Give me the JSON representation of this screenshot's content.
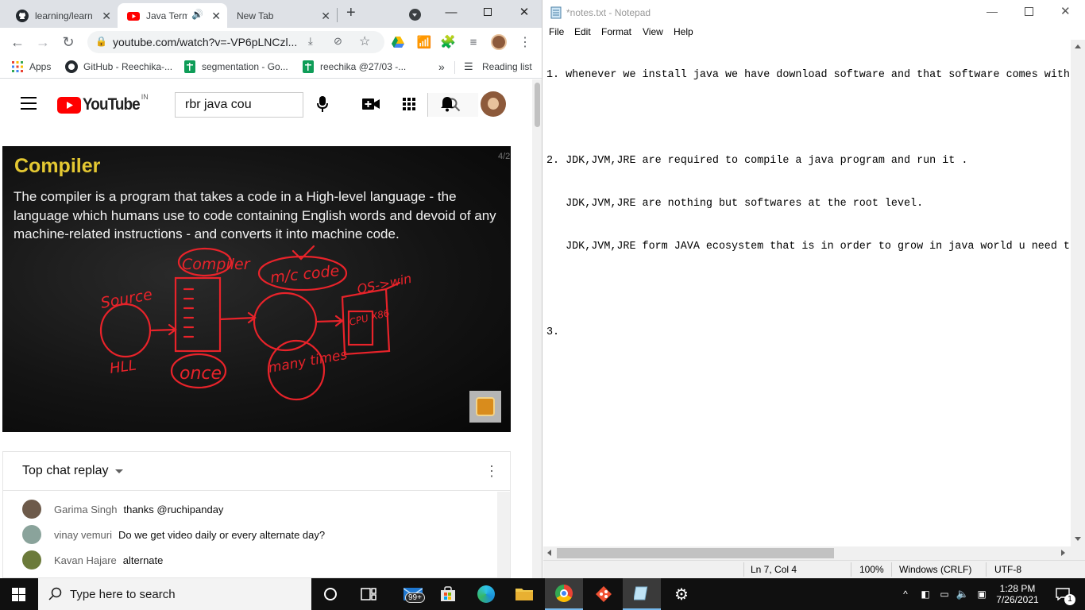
{
  "browser": {
    "tabs": [
      {
        "title": "learning/learn",
        "favicon": "github-icon"
      },
      {
        "title": "Java Term",
        "favicon": "youtube-icon",
        "audio": "speaker-icon"
      },
      {
        "title": "New Tab"
      }
    ],
    "url": "youtube.com/watch?v=-VP6pLNCzl...",
    "bookmarks": [
      {
        "label": "Apps"
      },
      {
        "label": "GitHub - Reechika-..."
      },
      {
        "label": "segmentation - Go..."
      },
      {
        "label": "reechika @27/03 -..."
      }
    ],
    "bookmarks_overflow": "»",
    "reading_list": "Reading list"
  },
  "youtube": {
    "logo": "YouTube",
    "country": "IN",
    "search_value": "rbr java cou",
    "video": {
      "slide_title": "Compiler",
      "slide_text": "The compiler is a program that takes a code in a High-level language - the language which humans use to code containing English words and devoid of any machine-related instructions - and converts it into machine code.",
      "slide_counter": "4/2",
      "handwriting": {
        "source": "Source",
        "compiler": "Compiler",
        "mc_code": "m/c code",
        "os_win": "OS->win",
        "cpu": "CPU X86",
        "hll": "HLL",
        "once": "once",
        "many_times": "many times"
      }
    },
    "chat": {
      "header": "Top chat replay",
      "messages": [
        {
          "author": "Garima Singh",
          "text": "thanks @ruchipanday",
          "color": "#6d5a4a"
        },
        {
          "author": "vinay vemuri",
          "text": "Do we get video daily or every alternate day?",
          "color": "#8aa39b"
        },
        {
          "author": "Kavan Hajare",
          "text": "alternate",
          "color": "#6b7a3a"
        }
      ]
    }
  },
  "notepad": {
    "title": "*notes.txt - Notepad",
    "menu": [
      "File",
      "Edit",
      "Format",
      "View",
      "Help"
    ],
    "lines": [
      "1. whenever we install java we have download software and that software comes with",
      "",
      "2. JDK,JVM,JRE are required to compile a java program and run it .",
      "   JDK,JVM,JRE are nothing but softwares at the root level.",
      "   JDK,JVM,JRE form JAVA ecosystem that is in order to grow in java world u need t",
      "",
      "3. "
    ],
    "status": {
      "position": "Ln 7, Col 4",
      "zoom": "100%",
      "line_ending": "Windows (CRLF)",
      "encoding": "UTF-8"
    }
  },
  "taskbar": {
    "search_placeholder": "Type here to search",
    "mail_badge": "99+",
    "time": "1:28 PM",
    "date": "7/26/2021",
    "notification_count": "1"
  },
  "colors": {
    "yt_red": "#ff0000",
    "slide_title": "#e4c832",
    "chalk_red": "#e8232a",
    "tab_strip": "#dee1e6"
  }
}
